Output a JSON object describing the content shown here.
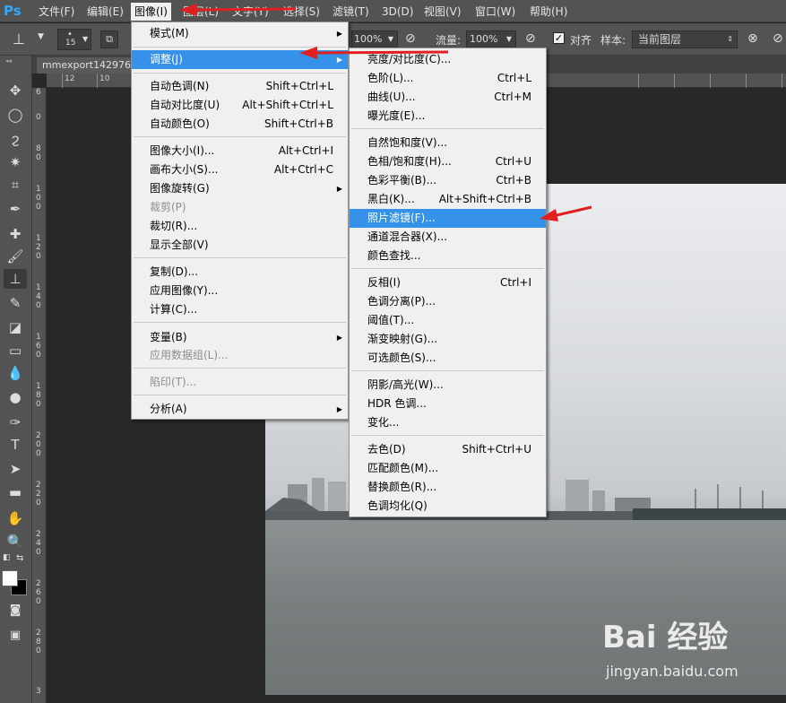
{
  "app": {
    "logo": "Ps"
  },
  "menubar": {
    "items": [
      "文件(F)",
      "编辑(E)",
      "图像(I)",
      "图层(L)",
      "文字(Y)",
      "选择(S)",
      "滤镜(T)",
      "3D(D)",
      "视图(V)",
      "窗口(W)",
      "帮助(H)"
    ],
    "active_index": 2
  },
  "options": {
    "brush_size": "15",
    "opacity_value": "100%",
    "flow_label": "流量:",
    "flow_value": "100%",
    "align_label": "对齐",
    "sample_label": "样本:",
    "sample_value": "当前图层"
  },
  "document": {
    "tab_title": "mmexport142976"
  },
  "rulers": {
    "top_labels": [
      "12",
      "10"
    ],
    "left_labels": [
      "6",
      "0",
      "8",
      "0",
      "1",
      "0",
      "0",
      "1",
      "2",
      "0",
      "1",
      "4",
      "0",
      "1",
      "6",
      "0",
      "1",
      "8",
      "0",
      "2",
      "0",
      "0",
      "2",
      "2",
      "0",
      "2",
      "4",
      "0",
      "2",
      "6",
      "0",
      "2",
      "8",
      "0",
      "3"
    ]
  },
  "image_menu": {
    "items": [
      {
        "label": "模式(M)",
        "shortcut": "",
        "submenu": true
      },
      {
        "label": "调整(J)",
        "shortcut": "",
        "submenu": true,
        "highlighted": true
      },
      {
        "label": "自动色调(N)",
        "shortcut": "Shift+Ctrl+L"
      },
      {
        "label": "自动对比度(U)",
        "shortcut": "Alt+Shift+Ctrl+L"
      },
      {
        "label": "自动颜色(O)",
        "shortcut": "Shift+Ctrl+B"
      },
      {
        "label": "图像大小(I)...",
        "shortcut": "Alt+Ctrl+I"
      },
      {
        "label": "画布大小(S)...",
        "shortcut": "Alt+Ctrl+C"
      },
      {
        "label": "图像旋转(G)",
        "shortcut": "",
        "submenu": true
      },
      {
        "label": "裁剪(P)",
        "shortcut": "",
        "disabled": true
      },
      {
        "label": "裁切(R)...",
        "shortcut": ""
      },
      {
        "label": "显示全部(V)",
        "shortcut": ""
      },
      {
        "label": "复制(D)...",
        "shortcut": ""
      },
      {
        "label": "应用图像(Y)...",
        "shortcut": ""
      },
      {
        "label": "计算(C)...",
        "shortcut": ""
      },
      {
        "label": "变量(B)",
        "shortcut": "",
        "submenu": true
      },
      {
        "label": "应用数据组(L)...",
        "shortcut": "",
        "disabled": true
      },
      {
        "label": "陷印(T)...",
        "shortcut": "",
        "disabled": true
      },
      {
        "label": "分析(A)",
        "shortcut": "",
        "submenu": true
      }
    ]
  },
  "adjust_menu": {
    "items": [
      {
        "label": "亮度/对比度(C)...",
        "shortcut": ""
      },
      {
        "label": "色阶(L)...",
        "shortcut": "Ctrl+L"
      },
      {
        "label": "曲线(U)...",
        "shortcut": "Ctrl+M"
      },
      {
        "label": "曝光度(E)...",
        "shortcut": ""
      },
      {
        "label": "自然饱和度(V)...",
        "shortcut": ""
      },
      {
        "label": "色相/饱和度(H)...",
        "shortcut": "Ctrl+U"
      },
      {
        "label": "色彩平衡(B)...",
        "shortcut": "Ctrl+B"
      },
      {
        "label": "黑白(K)...",
        "shortcut": "Alt+Shift+Ctrl+B"
      },
      {
        "label": "照片滤镜(F)...",
        "shortcut": "",
        "highlighted": true
      },
      {
        "label": "通道混合器(X)...",
        "shortcut": ""
      },
      {
        "label": "颜色查找...",
        "shortcut": ""
      },
      {
        "label": "反相(I)",
        "shortcut": "Ctrl+I"
      },
      {
        "label": "色调分离(P)...",
        "shortcut": ""
      },
      {
        "label": "阈值(T)...",
        "shortcut": ""
      },
      {
        "label": "渐变映射(G)...",
        "shortcut": ""
      },
      {
        "label": "可选颜色(S)...",
        "shortcut": ""
      },
      {
        "label": "阴影/高光(W)...",
        "shortcut": ""
      },
      {
        "label": "HDR 色调...",
        "shortcut": ""
      },
      {
        "label": "变化...",
        "shortcut": ""
      },
      {
        "label": "去色(D)",
        "shortcut": "Shift+Ctrl+U"
      },
      {
        "label": "匹配颜色(M)...",
        "shortcut": ""
      },
      {
        "label": "替换颜色(R)...",
        "shortcut": ""
      },
      {
        "label": "色调均化(Q)",
        "shortcut": ""
      }
    ]
  },
  "watermark": {
    "brand": "Bai 经验",
    "url": "jingyan.baidu.com"
  },
  "colors": {
    "accent": "#3592e8",
    "annotation": "#e02020"
  }
}
